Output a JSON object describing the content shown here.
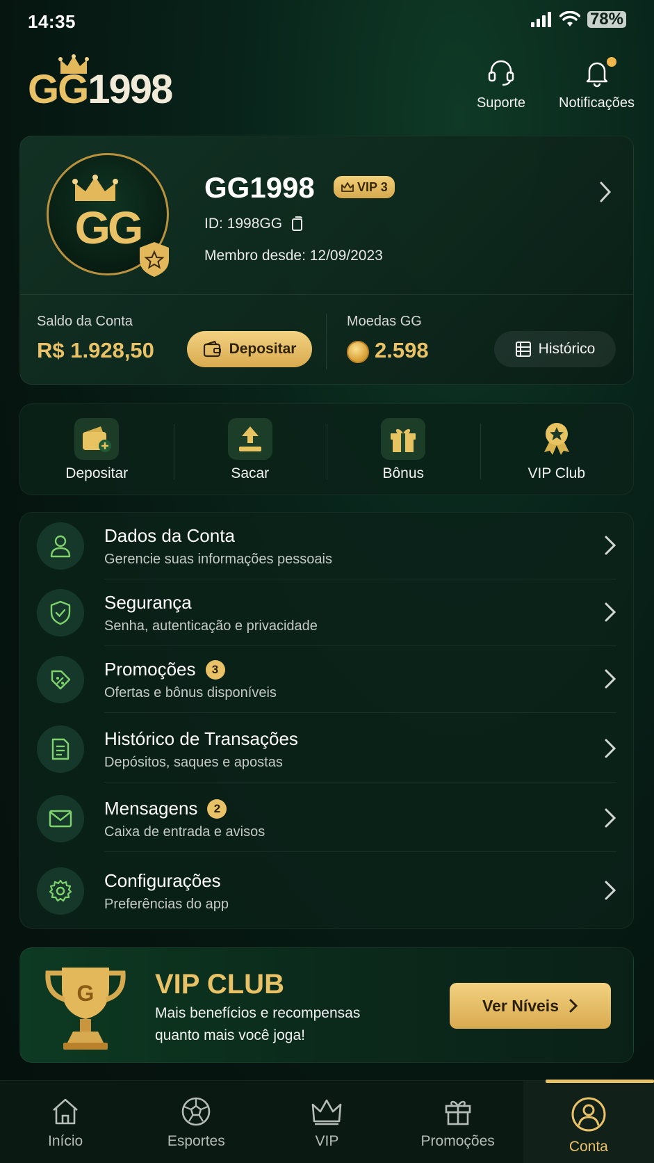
{
  "status_bar": {
    "time": "14:35",
    "battery": "78%"
  },
  "header": {
    "logo_gg": "GG",
    "logo_number": "1998",
    "support_label": "Suporte",
    "notifications_label": "Notificações"
  },
  "profile": {
    "avatar_text": "GG",
    "name": "GG1998",
    "vip_badge": "VIP 3",
    "id": "ID: 1998GG",
    "member_since": "Membro desde: 12/09/2023",
    "balance_label": "Saldo da Conta",
    "balance_value": "R$ 1.928,50",
    "deposit_button": "Depositar",
    "coins_label": "Moedas GG",
    "coins_value": "2.598",
    "history_button": "Histórico"
  },
  "quick_actions": [
    {
      "label": "Depositar",
      "icon": "wallet-plus-icon"
    },
    {
      "label": "Sacar",
      "icon": "upload-icon"
    },
    {
      "label": "Bônus",
      "icon": "gift-icon"
    },
    {
      "label": "VIP Club",
      "icon": "medal-icon"
    }
  ],
  "menu": [
    {
      "title": "Dados da Conta",
      "subtitle": "Gerencie suas informações pessoais",
      "icon": "user-icon"
    },
    {
      "title": "Segurança",
      "subtitle": "Senha, autenticação e privacidade",
      "icon": "shield-check-icon"
    },
    {
      "title": "Promoções",
      "subtitle": "Ofertas e bônus disponíveis",
      "icon": "discount-tag-icon",
      "badge": "3"
    },
    {
      "title": "Histórico de Transações",
      "subtitle": "Depósitos, saques e apostas",
      "icon": "document-icon"
    },
    {
      "title": "Mensagens",
      "subtitle": "Caixa de entrada e avisos",
      "icon": "mail-icon",
      "badge": "2"
    },
    {
      "title": "Configurações",
      "subtitle": "Preferências do app",
      "icon": "gear-icon"
    }
  ],
  "vip_banner": {
    "title": "VIP CLUB",
    "subtitle_line1": "Mais benefícios e recompensas",
    "subtitle_line2": "quanto mais você joga!",
    "button": "Ver Níveis",
    "trophy_letter": "G"
  },
  "bottom_nav": [
    {
      "label": "Início",
      "icon": "home-icon"
    },
    {
      "label": "Esportes",
      "icon": "soccer-ball-icon"
    },
    {
      "label": "VIP",
      "icon": "crown-icon"
    },
    {
      "label": "Promoções",
      "icon": "gift-icon"
    },
    {
      "label": "Conta",
      "icon": "account-icon",
      "active": true
    }
  ],
  "colors": {
    "accent_gold": "#e9c268",
    "background": "#061510",
    "card": "#0b2219"
  }
}
